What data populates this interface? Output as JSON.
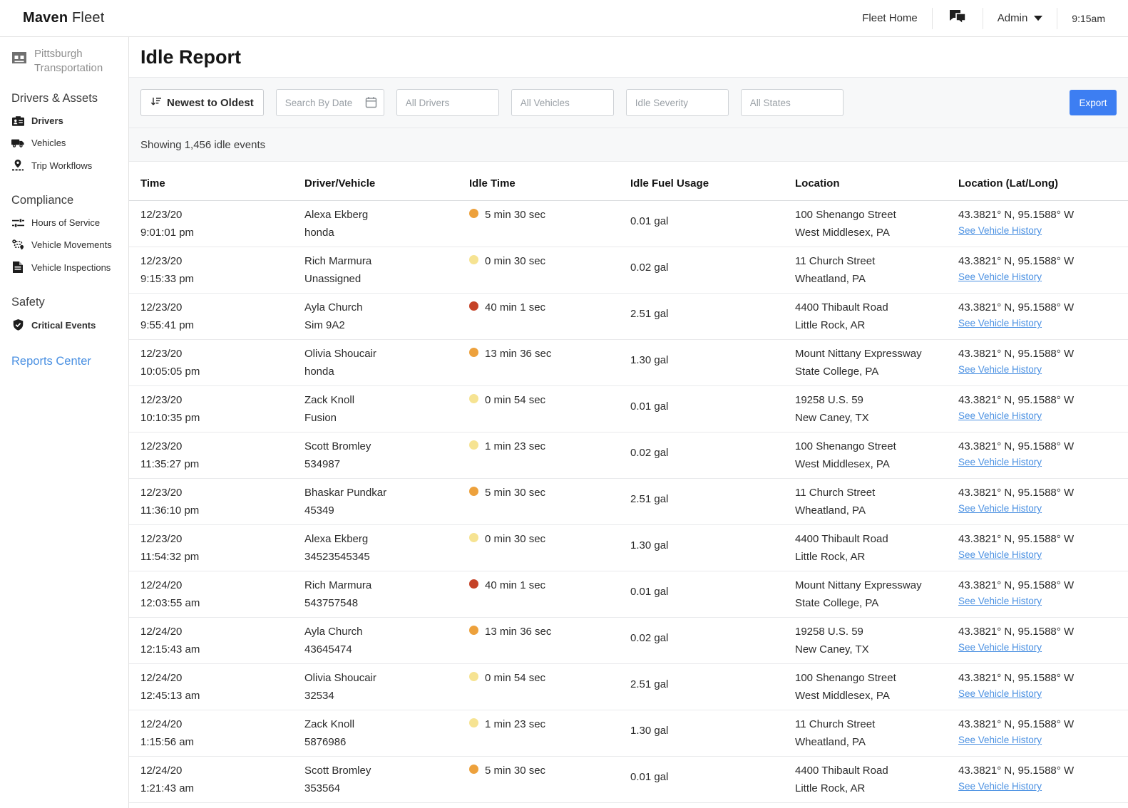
{
  "topbar": {
    "brand_bold": "Maven",
    "brand_light": "Fleet",
    "fleet_home_label": "Fleet Home",
    "admin_label": "Admin",
    "time": "9:15am"
  },
  "sidebar": {
    "org_name": "Pittsburgh Transportation",
    "sections": [
      {
        "title": "Drivers & Assets",
        "items": [
          {
            "label": "Drivers"
          },
          {
            "label": "Vehicles"
          },
          {
            "label": "Trip Workflows"
          }
        ]
      },
      {
        "title": "Compliance",
        "items": [
          {
            "label": "Hours of Service"
          },
          {
            "label": "Vehicle Movements"
          },
          {
            "label": "Vehicle Inspections"
          }
        ]
      },
      {
        "title": "Safety",
        "items": [
          {
            "label": "Critical Events"
          }
        ]
      }
    ],
    "reports_link": "Reports Center"
  },
  "main": {
    "title": "Idle Report",
    "filters": {
      "sort_label": "Newest to Oldest",
      "date_placeholder": "Search By Date",
      "drivers_placeholder": "All Drivers",
      "vehicles_placeholder": "All Vehicles",
      "severity_placeholder": "Idle Severity",
      "states_placeholder": "All States",
      "export_label": "Export"
    },
    "summary": "Showing 1,456 idle events"
  },
  "severity_colors": {
    "low": "#F6E392",
    "medium": "#EDA13C",
    "high": "#C54227"
  },
  "table": {
    "columns": [
      "Time",
      "Driver/Vehicle",
      "Idle Time",
      "Idle Fuel Usage",
      "Location",
      "Location (Lat/Long)"
    ],
    "link_label": "See Vehicle History",
    "rows": [
      {
        "date": "12/23/20",
        "time": "9:01:01 pm",
        "driver": "Alexa Ekberg",
        "vehicle": "honda",
        "severity": "medium",
        "idle_time": "5 min 30 sec",
        "fuel": "0.01 gal",
        "address": "100 Shenango Street",
        "city": "West Middlesex, PA",
        "latlong": "43.3821° N, 95.1588° W"
      },
      {
        "date": "12/23/20",
        "time": "9:15:33 pm",
        "driver": "Rich Marmura",
        "vehicle": "Unassigned",
        "severity": "low",
        "idle_time": "0 min 30 sec",
        "fuel": "0.02 gal",
        "address": "11 Church Street",
        "city": "Wheatland, PA",
        "latlong": "43.3821° N, 95.1588° W"
      },
      {
        "date": "12/23/20",
        "time": "9:55:41 pm",
        "driver": "Ayla Church",
        "vehicle": "Sim 9A2",
        "severity": "high",
        "idle_time": "40 min 1 sec",
        "fuel": "2.51 gal",
        "address": "4400 Thibault Road",
        "city": "Little Rock, AR",
        "latlong": "43.3821° N, 95.1588° W"
      },
      {
        "date": "12/23/20",
        "time": "10:05:05 pm",
        "driver": "Olivia Shoucair",
        "vehicle": "honda",
        "severity": "medium",
        "idle_time": "13 min 36 sec",
        "fuel": "1.30 gal",
        "address": "Mount Nittany Expressway",
        "city": "State College, PA",
        "latlong": "43.3821° N, 95.1588° W"
      },
      {
        "date": "12/23/20",
        "time": "10:10:35 pm",
        "driver": "Zack Knoll",
        "vehicle": "Fusion",
        "severity": "low",
        "idle_time": "0 min 54 sec",
        "fuel": "0.01 gal",
        "address": "19258 U.S. 59",
        "city": "New Caney, TX",
        "latlong": "43.3821° N, 95.1588° W"
      },
      {
        "date": "12/23/20",
        "time": "11:35:27 pm",
        "driver": "Scott Bromley",
        "vehicle": "534987",
        "severity": "low",
        "idle_time": "1 min 23 sec",
        "fuel": "0.02 gal",
        "address": "100 Shenango Street",
        "city": "West Middlesex, PA",
        "latlong": "43.3821° N, 95.1588° W"
      },
      {
        "date": "12/23/20",
        "time": "11:36:10 pm",
        "driver": "Bhaskar Pundkar",
        "vehicle": "45349",
        "severity": "medium",
        "idle_time": "5 min 30 sec",
        "fuel": "2.51 gal",
        "address": "11 Church Street",
        "city": "Wheatland, PA",
        "latlong": "43.3821° N, 95.1588° W"
      },
      {
        "date": "12/23/20",
        "time": "11:54:32 pm",
        "driver": "Alexa Ekberg",
        "vehicle": "34523545345",
        "severity": "low",
        "idle_time": "0 min 30 sec",
        "fuel": "1.30 gal",
        "address": "4400 Thibault Road",
        "city": "Little Rock, AR",
        "latlong": "43.3821° N, 95.1588° W"
      },
      {
        "date": "12/24/20",
        "time": "12:03:55 am",
        "driver": "Rich Marmura",
        "vehicle": "543757548",
        "severity": "high",
        "idle_time": "40 min 1 sec",
        "fuel": "0.01 gal",
        "address": "Mount Nittany Expressway",
        "city": "State College, PA",
        "latlong": "43.3821° N, 95.1588° W"
      },
      {
        "date": "12/24/20",
        "time": "12:15:43 am",
        "driver": "Ayla Church",
        "vehicle": "43645474",
        "severity": "medium",
        "idle_time": "13 min 36 sec",
        "fuel": "0.02 gal",
        "address": "19258 U.S. 59",
        "city": "New Caney, TX",
        "latlong": "43.3821° N, 95.1588° W"
      },
      {
        "date": "12/24/20",
        "time": "12:45:13 am",
        "driver": "Olivia Shoucair",
        "vehicle": "32534",
        "severity": "low",
        "idle_time": "0 min 54 sec",
        "fuel": "2.51 gal",
        "address": "100 Shenango Street",
        "city": "West Middlesex, PA",
        "latlong": "43.3821° N, 95.1588° W"
      },
      {
        "date": "12/24/20",
        "time": "1:15:56 am",
        "driver": "Zack Knoll",
        "vehicle": "5876986",
        "severity": "low",
        "idle_time": "1 min 23 sec",
        "fuel": "1.30 gal",
        "address": "11 Church Street",
        "city": "Wheatland, PA",
        "latlong": "43.3821° N, 95.1588° W"
      },
      {
        "date": "12/24/20",
        "time": "1:21:43 am",
        "driver": "Scott Bromley",
        "vehicle": "353564",
        "severity": "medium",
        "idle_time": "5 min 30 sec",
        "fuel": "0.01 gal",
        "address": "4400 Thibault Road",
        "city": "Little Rock, AR",
        "latlong": "43.3821° N, 95.1588° W"
      }
    ]
  }
}
